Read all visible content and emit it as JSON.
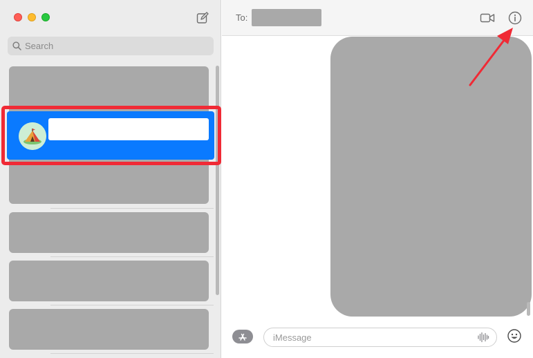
{
  "sidebar": {
    "search": {
      "placeholder": "Search"
    },
    "selected_conversation": {
      "avatar": "camping-tent-avatar"
    }
  },
  "header": {
    "to_label": "To:"
  },
  "composer": {
    "placeholder": "iMessage"
  },
  "icons": {
    "compose": "compose-icon",
    "search": "search-icon",
    "video": "video-camera-icon",
    "info": "info-icon",
    "apps": "app-store-icon",
    "audio": "waveform-icon",
    "emoji": "emoji-icon"
  },
  "colors": {
    "selection": "#0a7aff",
    "highlight_outline": "#f02a35",
    "annotation_arrow": "#f02a35",
    "redaction": "#a9a9a9"
  }
}
